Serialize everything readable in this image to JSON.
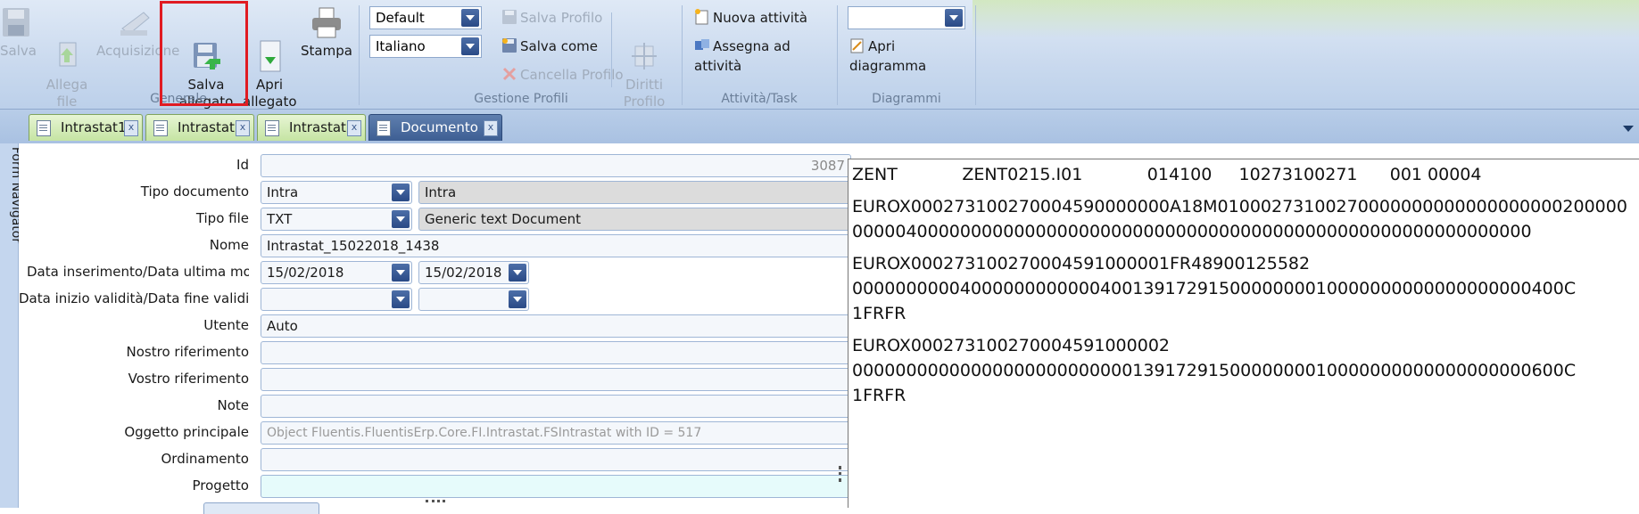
{
  "ribbon": {
    "generale": {
      "label": "Generale",
      "salva": "Salva",
      "allega_file": "Allega\nfile",
      "acquisizione": "Acquisizione",
      "salva_allegato": "Salva\nallegato",
      "apri_allegato": "Apri\nallegato",
      "stampa": "Stampa"
    },
    "gestione_profili": {
      "label": "Gestione Profili",
      "profile_select": "Default",
      "language_select": "Italiano",
      "salva_profilo": "Salva Profilo",
      "salva_come": "Salva come",
      "cancella_profilo": "Cancella Profilo",
      "diritti_profilo": "Diritti\nProfilo"
    },
    "attivita": {
      "label": "Attività/Task",
      "nuova_attivita": "Nuova attività",
      "assegna_attivita": "Assegna ad attività"
    },
    "diagrammi": {
      "label": "Diagrammi",
      "select": "",
      "apri_diagramma": "Apri diagramma"
    }
  },
  "tabs": [
    {
      "label": "Intrastat1"
    },
    {
      "label": "Intrastat"
    },
    {
      "label": "Intrastat"
    },
    {
      "label": "Documento"
    }
  ],
  "side_nav": "Form Navigator",
  "form": {
    "id": {
      "label": "Id",
      "value": "3087"
    },
    "tipo_documento": {
      "label": "Tipo documento",
      "value": "Intra",
      "desc": "Intra"
    },
    "tipo_file": {
      "label": "Tipo file",
      "value": "TXT",
      "desc": "Generic text Document"
    },
    "nome": {
      "label": "Nome",
      "value": "Intrastat_15022018_1438"
    },
    "data_ins": {
      "label": "Data inserimento/Data ultima modific",
      "value1": "15/02/2018",
      "value2": "15/02/2018"
    },
    "data_val": {
      "label": "Data inizio validità/Data fine validità",
      "value1": "",
      "value2": ""
    },
    "utente": {
      "label": "Utente",
      "value": "Auto"
    },
    "nostro_rif": {
      "label": "Nostro riferimento",
      "value": ""
    },
    "vostro_rif": {
      "label": "Vostro riferimento",
      "value": ""
    },
    "note": {
      "label": "Note",
      "value": ""
    },
    "oggetto": {
      "label": "Oggetto principale",
      "value": "Object Fluentis.FluentisErp.Core.FI.Intrastat.FSIntrastat with ID = 517"
    },
    "ordinamento": {
      "label": "Ordinamento",
      "value": ""
    },
    "progetto": {
      "label": "Progetto",
      "value": ""
    }
  },
  "document": {
    "lines": [
      "ZENT            ZENT0215.I01            014100     10273100271      001 00004",
      "",
      "EUROX000273100270004590000000A18M01000273100270000000000000000000200000",
      "000004000000000000000000000000000000000000000000000000000000000",
      "",
      "EUROX000273100270004591000001FR48900125582",
      "000000000040000000000004001391729150000000010000000000000000000400C",
      "1FRFR",
      "",
      "EUROX000273100270004591000002",
      "000000000000000000000000001391729150000000010000000000000000000600C",
      "1FRFR"
    ]
  },
  "colors": {
    "highlight": "#e01b22",
    "tab_inactive": "#c5e4a3",
    "tab_active": "#3d5e93",
    "progetto_field": "#e6fbfb"
  }
}
